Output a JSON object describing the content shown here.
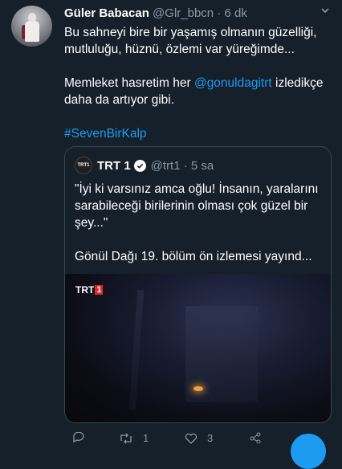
{
  "tweet": {
    "author_name": "Güler Babacan",
    "author_handle": "@Glr_bbcn",
    "time": "6 dk",
    "line1": "Bu sahneyi bire bir yaşamış olmanın güzelliği, mutluluğu, hüznü, özlemi var yüreğimde...",
    "line2_prefix": "Memleket hasretim her ",
    "line2_mention": "@gonuldagitrt",
    "line2_suffix": " izledikçe daha da artıyor gibi.",
    "hashtag": "#SevenBirKalp"
  },
  "quoted": {
    "logo_text": "TRT1",
    "name": "TRT 1",
    "handle": "@trt1",
    "time": "5 sa",
    "text1": "\"İyi ki varsınız amca oğlu! İnsanın, yaralarını sarabileceği birilerinin olması çok güzel bir şey...\"",
    "text2": "Gönül Dağı 19. bölüm ön izlemesi yayınd...",
    "video_badge_trt": "TRT",
    "video_badge_1": "1"
  },
  "actions": {
    "retweets": "1",
    "likes": "3"
  },
  "colors": {
    "background": "#15202b",
    "accent": "#1d9bf0",
    "muted": "#8b98a5",
    "border": "#38444d"
  }
}
